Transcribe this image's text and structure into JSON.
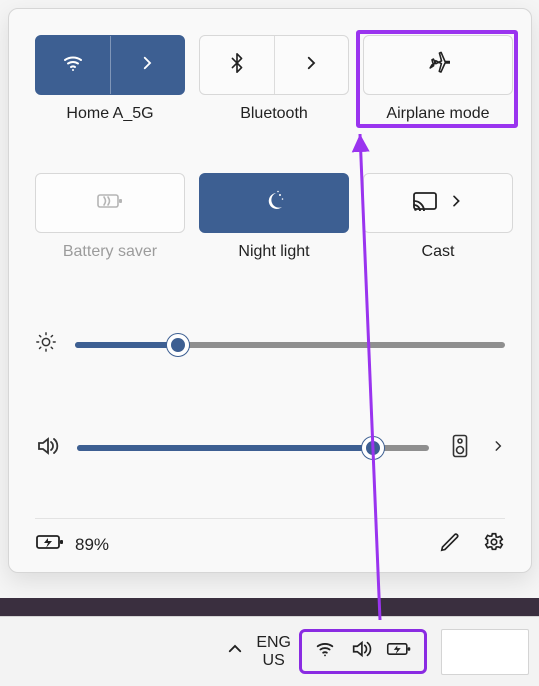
{
  "accent": "#3d5f92",
  "highlight": "#9a34ef",
  "tiles": {
    "wifi": {
      "label": "Home A_5G",
      "active": true,
      "expandable": true
    },
    "bluetooth": {
      "label": "Bluetooth",
      "active": false,
      "expandable": true
    },
    "airplane": {
      "label": "Airplane mode",
      "active": false,
      "expandable": false
    },
    "battery": {
      "label": "Battery saver",
      "active": false,
      "disabled": true
    },
    "nightlight": {
      "label": "Night light",
      "active": true
    },
    "cast": {
      "label": "Cast",
      "active": false,
      "expandable": true
    }
  },
  "sliders": {
    "brightness": {
      "percent": 24
    },
    "volume": {
      "percent": 84
    }
  },
  "battery": {
    "text": "89%"
  },
  "taskbar": {
    "language_top": "ENG",
    "language_bottom": "US"
  }
}
